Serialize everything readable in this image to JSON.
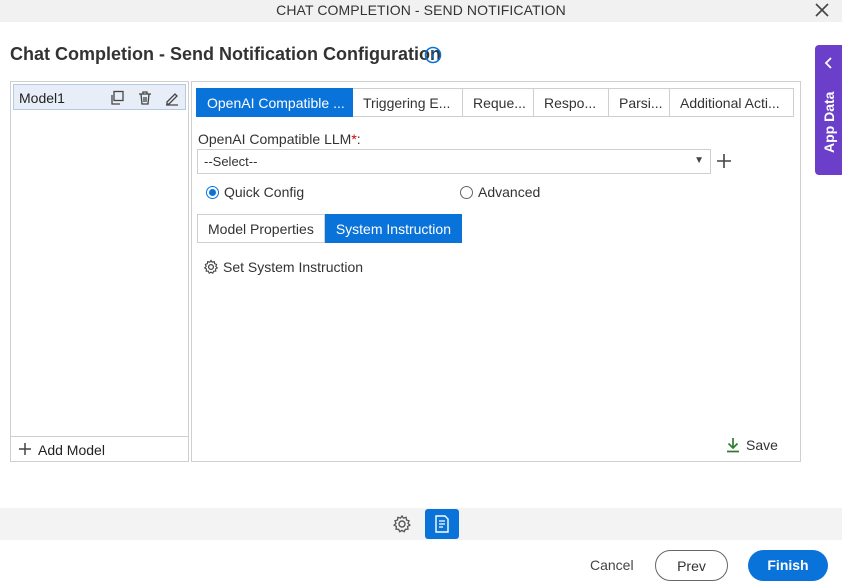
{
  "window": {
    "title": "CHAT COMPLETION - SEND NOTIFICATION"
  },
  "page": {
    "heading": "Chat Completion - Send Notification Configuration"
  },
  "side_tab": {
    "label": "App Data"
  },
  "models": {
    "items": [
      {
        "name": "Model1"
      }
    ],
    "add_label": "Add Model"
  },
  "tabs": [
    {
      "label": "OpenAI Compatible ...",
      "active": true
    },
    {
      "label": "Triggering E..."
    },
    {
      "label": "Reque..."
    },
    {
      "label": "Respo..."
    },
    {
      "label": "Parsi..."
    },
    {
      "label": "Additional Acti..."
    }
  ],
  "llm": {
    "label": "OpenAI Compatible LLM",
    "required_mark": "*",
    "label_suffix": ":",
    "selected": "--Select--"
  },
  "config_mode": {
    "options": [
      {
        "label": "Quick Config",
        "checked": true
      },
      {
        "label": "Advanced",
        "checked": false
      }
    ]
  },
  "subtabs": [
    {
      "label": "Model Properties"
    },
    {
      "label": "System Instruction",
      "active": true
    }
  ],
  "system_instruction": {
    "link_label": "Set System Instruction"
  },
  "save_label": "Save",
  "footer": {
    "cancel": "Cancel",
    "prev": "Prev",
    "finish": "Finish"
  },
  "colors": {
    "accent": "#0a73d9",
    "side_tab": "#6b3fc9",
    "required": "#cc0000",
    "save_icon": "#2e7d32"
  }
}
